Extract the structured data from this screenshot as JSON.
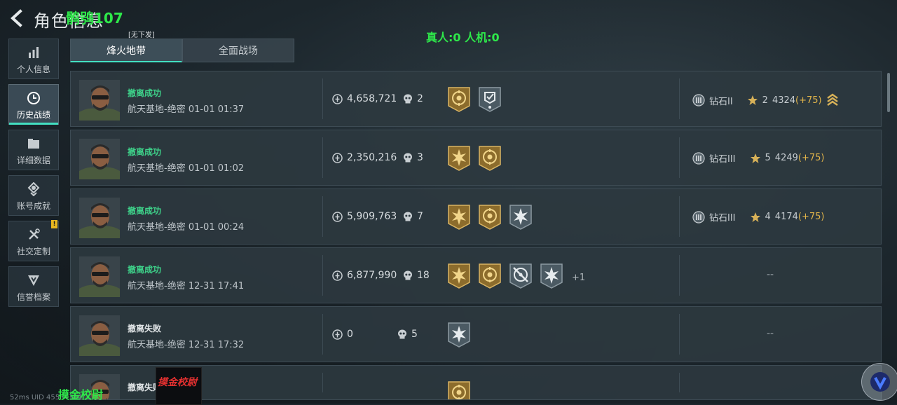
{
  "header": {
    "title": "角色信息",
    "overlay_text": "鹘鸮107",
    "stats_text": "真人:0 人机:0",
    "tag": "[无下发]"
  },
  "sidebar": {
    "items": [
      {
        "label": "个人信息",
        "icon": "bar-chart-icon",
        "active": false
      },
      {
        "label": "历史战绩",
        "icon": "clock-icon",
        "active": true
      },
      {
        "label": "详细数据",
        "icon": "folder-icon",
        "active": false
      },
      {
        "label": "账号成就",
        "icon": "medal-icon",
        "active": false
      },
      {
        "label": "社交定制",
        "icon": "tools-icon",
        "active": false,
        "badge": "!"
      },
      {
        "label": "信誉档案",
        "icon": "shield-icon",
        "active": false
      }
    ]
  },
  "tabs": [
    {
      "label": "烽火地带",
      "active": true
    },
    {
      "label": "全面战场",
      "active": false
    }
  ],
  "records": [
    {
      "result": "撤离成功",
      "success": true,
      "map": "航天基地-绝密 01-01 01:37",
      "value": "4,658,721",
      "kills": "2",
      "medals": [
        "emblem-gold",
        "badge-grey-check"
      ],
      "more": "",
      "rank_tier": "钻石II",
      "stars": "2",
      "points": "4324",
      "gain": "(+75)",
      "rank_up": true
    },
    {
      "result": "撤离成功",
      "success": true,
      "map": "航天基地-绝密 01-01 01:02",
      "value": "2,350,216",
      "kills": "3",
      "medals": [
        "burst-gold",
        "emblem-gold"
      ],
      "more": "",
      "rank_tier": "钻石III",
      "stars": "5",
      "points": "4249",
      "gain": "(+75)",
      "rank_up": false
    },
    {
      "result": "撤离成功",
      "success": true,
      "map": "航天基地-绝密 01-01 00:24",
      "value": "5,909,763",
      "kills": "7",
      "medals": [
        "burst-gold",
        "emblem-gold",
        "burst-grey"
      ],
      "more": "",
      "rank_tier": "钻石III",
      "stars": "4",
      "points": "4174",
      "gain": "(+75)",
      "rank_up": false
    },
    {
      "result": "撤离成功",
      "success": true,
      "map": "航天基地-绝密 12-31 17:41",
      "value": "6,877,990",
      "kills": "18",
      "medals": [
        "burst-gold",
        "emblem-gold",
        "crosshair-grey",
        "burst-grey"
      ],
      "more": "+1",
      "rank_tier": "",
      "stars": "",
      "points": "",
      "gain": "",
      "rank_up": false,
      "no_rank": "--"
    },
    {
      "result": "撤离失败",
      "success": false,
      "map": "航天基地-绝密 12-31 17:32",
      "value": "0",
      "kills": "5",
      "medals": [
        "burst-grey"
      ],
      "more": "",
      "rank_tier": "",
      "stars": "",
      "points": "",
      "gain": "",
      "rank_up": false,
      "no_rank": "--"
    }
  ],
  "partial_row": {
    "result": "撤离失败"
  },
  "footer": {
    "rank_title": "摸金校尉",
    "picture_text": "摸金校尉",
    "uid_text": "52ms   UID 45534304"
  },
  "colors": {
    "accent": "#43e0c2",
    "success": "#3ed28a",
    "gold": "#b8923e",
    "overlay_green": "#2ee84a"
  }
}
